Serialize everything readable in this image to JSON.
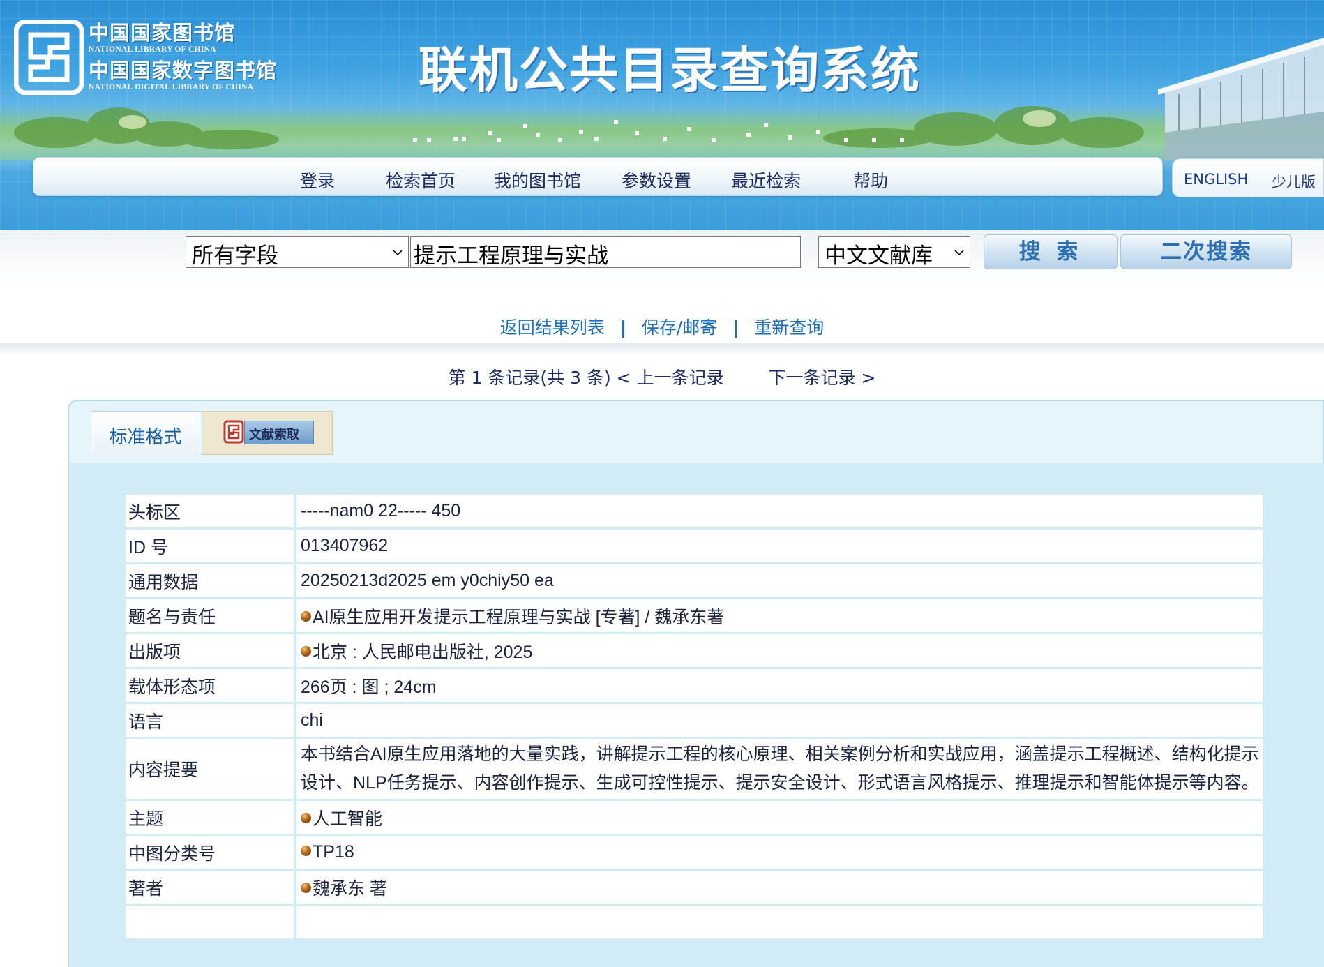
{
  "header": {
    "logo_cn_1": "中国国家图书馆",
    "logo_en_1": "NATIONAL LIBRARY OF CHINA",
    "logo_cn_2": "中国国家数字图书馆",
    "logo_en_2": "NATIONAL DIGITAL LIBRARY OF CHINA",
    "title": "联机公共目录查询系统",
    "nav": [
      "登录",
      "检索首页",
      "我的图书馆",
      "参数设置",
      "最近检索",
      "帮助"
    ],
    "lang": [
      "ENGLISH",
      "少儿版"
    ],
    "logo_icon": "library-seal-icon"
  },
  "search": {
    "field_select": "所有字段",
    "query": "提示工程原理与实战",
    "db_select": "中文文献库",
    "search_btn": "搜 索",
    "refine_btn": "二次搜索"
  },
  "links": {
    "back": "返回结果列表",
    "save": "保存/邮寄",
    "new_query": "重新查询",
    "separator": "|"
  },
  "record_nav": {
    "position": "第 1 条记录(共 3 条)",
    "prev": "< 上一条记录",
    "next": "下一条记录 >"
  },
  "tabs": {
    "standard": "标准格式",
    "doc_request": "文献索取"
  },
  "record": {
    "rows": [
      {
        "label": "头标区",
        "value": "-----nam0 22----- 450",
        "linked": false
      },
      {
        "label": "ID 号",
        "value": "013407962",
        "linked": false
      },
      {
        "label": "通用数据",
        "value": "20250213d2025 em y0chiy50 ea",
        "linked": false
      },
      {
        "label": "题名与责任",
        "value": "AI原生应用开发提示工程原理与实战 [专著] / 魏承东著",
        "linked": true
      },
      {
        "label": "出版项",
        "value": "北京 : 人民邮电出版社, 2025",
        "linked": true
      },
      {
        "label": "载体形态项",
        "value": "266页 : 图 ; 24cm",
        "linked": false
      },
      {
        "label": "语言",
        "value": "chi",
        "linked": false
      },
      {
        "label": "内容提要",
        "value": "本书结合AI原生应用落地的大量实践，讲解提示工程的核心原理、相关案例分析和实战应用，涵盖提示工程概述、结构化提示设计、NLP任务提示、内容创作提示、生成可控性提示、提示安全设计、形式语言风格提示、推理提示和智能体提示等内容。",
        "linked": false
      },
      {
        "label": "主题",
        "value": "人工智能",
        "linked": true
      },
      {
        "label": "中图分类号",
        "value": "TP18",
        "linked": true
      },
      {
        "label": "著者",
        "value": "魏承东 著",
        "linked": true
      },
      {
        "label": "",
        "value": "",
        "linked": false
      }
    ]
  },
  "colors": {
    "banner": "#3fa3e2",
    "nav_text": "#1c2c63",
    "link": "#1a6fb8",
    "panel_bg": "#d2ecf6"
  }
}
